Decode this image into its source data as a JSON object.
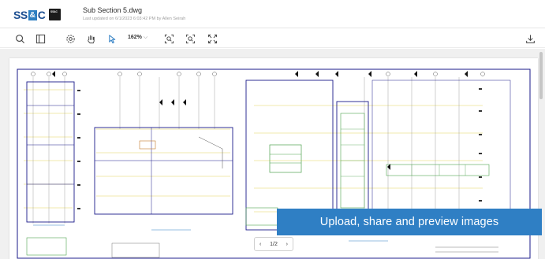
{
  "header": {
    "logo_text_left": "SS",
    "logo_text_mid": "&",
    "logo_text_right": "C",
    "brand_box_text": "SS&C",
    "file_title": "Sub Section 5.dwg",
    "file_subtitle": "Last updated on 6/1/2023 6:03:42 PM by Allen Seirah"
  },
  "toolbar": {
    "icons": [
      "search-icon",
      "sidebar-toggle-icon",
      "settings-icon",
      "pan-hand-icon",
      "select-pointer-icon",
      "zoom-in-icon",
      "zoom-out-icon",
      "fit-screen-icon",
      "download-icon"
    ],
    "zoom_level": "162%",
    "zoom_chevron": "⌵"
  },
  "viewer": {
    "pager": {
      "prev": "‹",
      "label": "1/2",
      "next": "›"
    }
  },
  "banner": {
    "text": "Upload, share and preview images"
  },
  "colors": {
    "accent": "#2f7fc4",
    "brand_blue": "#1d4f91",
    "drawing_line": "#1a1a8a",
    "drawing_yellow": "#e6d35a",
    "drawing_green": "#4fa34f"
  }
}
